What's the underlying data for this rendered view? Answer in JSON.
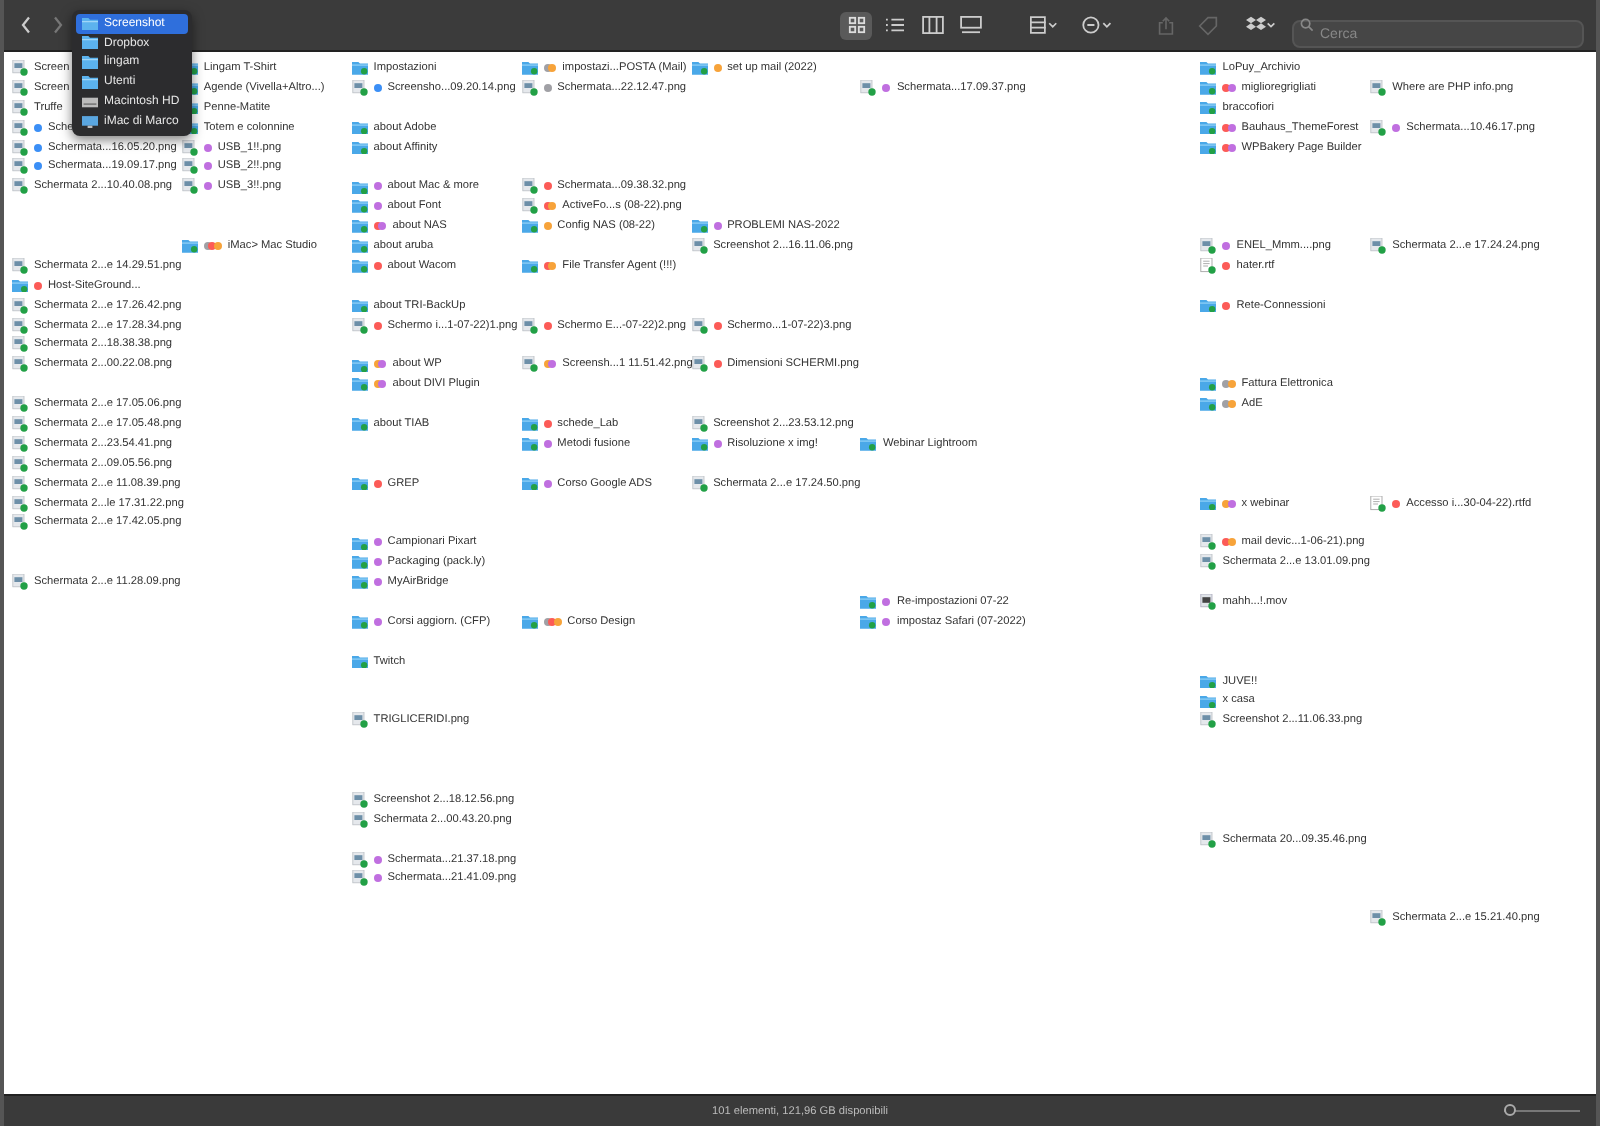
{
  "toolbar": {
    "view_buttons": [
      {
        "kind": "icons",
        "selected": true
      },
      {
        "kind": "list",
        "selected": false
      },
      {
        "kind": "columns",
        "selected": false
      },
      {
        "kind": "gallery",
        "selected": false
      }
    ],
    "search": {
      "placeholder": "Cerca"
    }
  },
  "path_menu": [
    {
      "kind": "folder",
      "label": "Screenshot",
      "selected": true
    },
    {
      "kind": "folder",
      "label": "Dropbox",
      "selected": false
    },
    {
      "kind": "folder",
      "label": "lingam",
      "selected": false
    },
    {
      "kind": "folder",
      "label": "Utenti",
      "selected": false
    },
    {
      "kind": "disk",
      "label": "Macintosh HD",
      "selected": false
    },
    {
      "kind": "computer",
      "label": "iMac di Marco",
      "selected": false
    }
  ],
  "columns": [
    {
      "slots": [
        {
          "kind": "image",
          "name": "Screen"
        },
        {
          "kind": "image",
          "name": "Screen"
        },
        {
          "kind": "image",
          "name": "Truffe"
        },
        {
          "kind": "image",
          "name": "Sche",
          "tags": [
            {
              "color": "#3b8ff6"
            }
          ]
        },
        {
          "kind": "image",
          "name": "Schermata...16.05.20.png",
          "tags": [
            {
              "color": "#3b8ff6"
            }
          ]
        },
        {
          "kind": "image",
          "name": "Schermata...19.09.17.png",
          "tags": [
            {
              "color": "#3b8ff6"
            }
          ]
        },
        {
          "kind": "image",
          "name": "Schermata 2...10.40.08.png"
        },
        {
          "kind": "blank"
        },
        {
          "kind": "blank"
        },
        {
          "kind": "blank"
        },
        {
          "kind": "image",
          "name": "Schermata 2...e 14.29.51.png"
        },
        {
          "kind": "folder",
          "name": "Host-SiteGround...",
          "tags": [
            {
              "color": "#fc5b57"
            }
          ]
        },
        {
          "kind": "image",
          "name": "Schermata 2...e 17.26.42.png"
        },
        {
          "kind": "image",
          "name": "Schermata 2...e 17.28.34.png"
        },
        {
          "kind": "image",
          "name": "Schermata 2...18.38.38.png"
        },
        {
          "kind": "image",
          "name": "Schermata 2...00.22.08.png"
        },
        {
          "kind": "blank"
        },
        {
          "kind": "image",
          "name": "Schermata 2...e 17.05.06.png"
        },
        {
          "kind": "image",
          "name": "Schermata 2...e 17.05.48.png"
        },
        {
          "kind": "image",
          "name": "Schermata 2...23.54.41.png"
        },
        {
          "kind": "image",
          "name": "Schermata 2...09.05.56.png"
        },
        {
          "kind": "image",
          "name": "Schermata 2...e 11.08.39.png"
        },
        {
          "kind": "image",
          "name": "Schermata 2...le 17.31.22.png"
        },
        {
          "kind": "image",
          "name": "Schermata 2...e 17.42.05.png"
        },
        {
          "kind": "blank"
        },
        {
          "kind": "blank"
        },
        {
          "kind": "image",
          "name": "Schermata 2...e 11.28.09.png"
        }
      ]
    },
    {
      "slots": [
        {
          "kind": "folder",
          "name": "Lingam T-Shirt"
        },
        {
          "kind": "folder",
          "name": "Agende (Vivella+Altro...)"
        },
        {
          "kind": "folder",
          "name": "Penne-Matite"
        },
        {
          "kind": "folder",
          "name": "Totem e colonnine"
        },
        {
          "kind": "image",
          "name": "USB_1!!.png",
          "tags": [
            {
              "color": "#c06fe0"
            }
          ]
        },
        {
          "kind": "image",
          "name": "USB_2!!.png",
          "tags": [
            {
              "color": "#c06fe0"
            }
          ]
        },
        {
          "kind": "image",
          "name": "USB_3!!.png",
          "tags": [
            {
              "color": "#c06fe0"
            }
          ]
        },
        {
          "kind": "blank"
        },
        {
          "kind": "blank"
        },
        {
          "kind": "folder",
          "name": "iMac> Mac Studio",
          "tags": [
            {
              "color": "#a0a0a5"
            },
            {
              "color": "#fc5b57"
            },
            {
              "color": "#f7a33a"
            }
          ]
        }
      ]
    },
    {
      "slots": [
        {
          "kind": "folder",
          "name": "Impostazioni"
        },
        {
          "kind": "image",
          "name": "Screensho...09.20.14.png",
          "tags": [
            {
              "color": "#3b8ff6"
            }
          ]
        },
        {
          "kind": "blank"
        },
        {
          "kind": "folder",
          "name": "about Adobe"
        },
        {
          "kind": "folder",
          "name": "about Affinity"
        },
        {
          "kind": "blank"
        },
        {
          "kind": "folder",
          "name": "about Mac & more",
          "tags": [
            {
              "color": "#c06fe0"
            }
          ]
        },
        {
          "kind": "folder",
          "name": "about Font",
          "tags": [
            {
              "color": "#c06fe0"
            }
          ]
        },
        {
          "kind": "folder",
          "name": "about NAS",
          "tags": [
            {
              "color": "#fc5b57"
            },
            {
              "color": "#c06fe0"
            }
          ]
        },
        {
          "kind": "folder",
          "name": "about aruba"
        },
        {
          "kind": "folder",
          "name": "about Wacom",
          "tags": [
            {
              "color": "#fc5b57"
            }
          ]
        },
        {
          "kind": "blank"
        },
        {
          "kind": "folder",
          "name": "about TRI-BackUp"
        },
        {
          "kind": "image",
          "name": "Schermo i...1-07-22)1.png",
          "tags": [
            {
              "color": "#fc5b57"
            }
          ]
        },
        {
          "kind": "blank"
        },
        {
          "kind": "folder",
          "name": "about WP",
          "tags": [
            {
              "color": "#f7a33a"
            },
            {
              "color": "#c06fe0"
            }
          ]
        },
        {
          "kind": "folder",
          "name": "about DIVI Plugin",
          "tags": [
            {
              "color": "#f7a33a"
            },
            {
              "color": "#c06fe0"
            }
          ]
        },
        {
          "kind": "blank"
        },
        {
          "kind": "folder",
          "name": "about TIAB"
        },
        {
          "kind": "blank"
        },
        {
          "kind": "blank"
        },
        {
          "kind": "folder",
          "name": "GREP",
          "tags": [
            {
              "color": "#fc5b57"
            }
          ]
        },
        {
          "kind": "blank"
        },
        {
          "kind": "blank"
        },
        {
          "kind": "folder",
          "name": "Campionari Pixart",
          "tags": [
            {
              "color": "#c06fe0"
            }
          ]
        },
        {
          "kind": "folder",
          "name": "Packaging (pack.ly)",
          "tags": [
            {
              "color": "#c06fe0"
            }
          ]
        },
        {
          "kind": "folder",
          "name": "MyAirBridge",
          "tags": [
            {
              "color": "#c06fe0"
            }
          ]
        },
        {
          "kind": "blank"
        },
        {
          "kind": "folder",
          "name": "Corsi aggiorn. (CFP)",
          "tags": [
            {
              "color": "#c06fe0"
            }
          ]
        },
        {
          "kind": "blank"
        },
        {
          "kind": "folder",
          "name": "Twitch"
        },
        {
          "kind": "blank"
        },
        {
          "kind": "blank"
        },
        {
          "kind": "image",
          "name": "TRIGLICERIDI.png"
        },
        {
          "kind": "blank"
        },
        {
          "kind": "blank"
        },
        {
          "kind": "blank"
        },
        {
          "kind": "image",
          "name": "Screenshot 2...18.12.56.png"
        },
        {
          "kind": "image",
          "name": "Schermata 2...00.43.20.png"
        },
        {
          "kind": "blank"
        },
        {
          "kind": "image",
          "name": "Schermata...21.37.18.png",
          "tags": [
            {
              "color": "#c06fe0"
            }
          ]
        },
        {
          "kind": "image",
          "name": "Schermata...21.41.09.png",
          "tags": [
            {
              "color": "#c06fe0"
            }
          ]
        }
      ]
    },
    {
      "slots": [
        {
          "kind": "folder",
          "name": "impostazi...POSTA (Mail)",
          "tags": [
            {
              "color": "#a0a0a5"
            },
            {
              "color": "#f7a33a"
            }
          ]
        },
        {
          "kind": "image",
          "name": "Schermata...22.12.47.png",
          "tags": [
            {
              "color": "#a0a0a5"
            }
          ]
        },
        {
          "kind": "blank"
        },
        {
          "kind": "blank"
        },
        {
          "kind": "blank"
        },
        {
          "kind": "blank"
        },
        {
          "kind": "image",
          "name": "Schermata...09.38.32.png",
          "tags": [
            {
              "color": "#fc5b57"
            }
          ]
        },
        {
          "kind": "image",
          "name": "ActiveFo...s (08-22).png",
          "tags": [
            {
              "color": "#fc5b57"
            },
            {
              "color": "#f7a33a"
            }
          ]
        },
        {
          "kind": "folder",
          "name": "Config NAS (08-22)",
          "tags": [
            {
              "color": "#f7a33a"
            }
          ]
        },
        {
          "kind": "blank"
        },
        {
          "kind": "folder",
          "name": "File Transfer Agent (!!!)",
          "tags": [
            {
              "color": "#fc5b57"
            },
            {
              "color": "#f7a33a"
            }
          ]
        },
        {
          "kind": "blank"
        },
        {
          "kind": "blank"
        },
        {
          "kind": "image",
          "name": "Schermo E...-07-22)2.png",
          "tags": [
            {
              "color": "#fc5b57"
            }
          ]
        },
        {
          "kind": "blank"
        },
        {
          "kind": "image",
          "name": "Screensh...1 11.51.42.png",
          "tags": [
            {
              "color": "#f7a33a"
            },
            {
              "color": "#c06fe0"
            }
          ]
        },
        {
          "kind": "blank"
        },
        {
          "kind": "blank"
        },
        {
          "kind": "folder",
          "name": "schede_Lab",
          "tags": [
            {
              "color": "#fc5b57"
            }
          ]
        },
        {
          "kind": "folder",
          "name": "Metodi fusione",
          "tags": [
            {
              "color": "#c06fe0"
            }
          ]
        },
        {
          "kind": "blank"
        },
        {
          "kind": "folder",
          "name": "Corso Google ADS",
          "tags": [
            {
              "color": "#c06fe0"
            }
          ]
        },
        {
          "kind": "blank"
        },
        {
          "kind": "blank"
        },
        {
          "kind": "blank"
        },
        {
          "kind": "blank"
        },
        {
          "kind": "blank"
        },
        {
          "kind": "blank"
        },
        {
          "kind": "folder",
          "name": "Corso Design",
          "tags": [
            {
              "color": "#a0a0a5"
            },
            {
              "color": "#fc5b57"
            },
            {
              "color": "#f7a33a"
            }
          ]
        }
      ]
    },
    {
      "slots": [
        {
          "kind": "folder",
          "name": "set up mail (2022)",
          "tags": [
            {
              "color": "#f7a33a"
            }
          ]
        },
        {
          "kind": "blank"
        },
        {
          "kind": "blank"
        },
        {
          "kind": "blank"
        },
        {
          "kind": "blank"
        },
        {
          "kind": "blank"
        },
        {
          "kind": "blank"
        },
        {
          "kind": "blank"
        },
        {
          "kind": "folder",
          "name": "PROBLEMI NAS-2022",
          "tags": [
            {
              "color": "#c06fe0"
            }
          ]
        },
        {
          "kind": "image",
          "name": "Screenshot 2...16.11.06.png"
        },
        {
          "kind": "blank"
        },
        {
          "kind": "blank"
        },
        {
          "kind": "blank"
        },
        {
          "kind": "image",
          "name": "Schermo...1-07-22)3.png",
          "tags": [
            {
              "color": "#fc5b57"
            }
          ]
        },
        {
          "kind": "blank"
        },
        {
          "kind": "image",
          "name": "Dimensioni SCHERMI.png",
          "tags": [
            {
              "color": "#fc5b57"
            }
          ]
        },
        {
          "kind": "blank"
        },
        {
          "kind": "blank"
        },
        {
          "kind": "image",
          "name": "Screenshot 2...23.53.12.png"
        },
        {
          "kind": "folder",
          "name": "Risoluzione x img!",
          "tags": [
            {
              "color": "#c06fe0"
            }
          ]
        },
        {
          "kind": "blank"
        },
        {
          "kind": "image",
          "name": "Schermata 2...e 17.24.50.png"
        }
      ]
    },
    {
      "slots": [
        {
          "kind": "blank"
        },
        {
          "kind": "image",
          "name": "Schermata...17.09.37.png",
          "tags": [
            {
              "color": "#c06fe0"
            }
          ]
        },
        {
          "kind": "blank"
        },
        {
          "kind": "blank"
        },
        {
          "kind": "blank"
        },
        {
          "kind": "blank"
        },
        {
          "kind": "blank"
        },
        {
          "kind": "blank"
        },
        {
          "kind": "blank"
        },
        {
          "kind": "blank"
        },
        {
          "kind": "blank"
        },
        {
          "kind": "blank"
        },
        {
          "kind": "blank"
        },
        {
          "kind": "blank"
        },
        {
          "kind": "blank"
        },
        {
          "kind": "blank"
        },
        {
          "kind": "blank"
        },
        {
          "kind": "blank"
        },
        {
          "kind": "blank"
        },
        {
          "kind": "folder",
          "name": "Webinar Lightroom"
        },
        {
          "kind": "blank"
        },
        {
          "kind": "blank"
        },
        {
          "kind": "blank"
        },
        {
          "kind": "blank"
        },
        {
          "kind": "blank"
        },
        {
          "kind": "blank"
        },
        {
          "kind": "blank"
        },
        {
          "kind": "folder",
          "name": "Re-impostazioni 07-22",
          "tags": [
            {
              "color": "#c06fe0"
            }
          ]
        },
        {
          "kind": "folder",
          "name": "impostaz Safari (07-2022)",
          "tags": [
            {
              "color": "#c06fe0"
            }
          ]
        }
      ]
    },
    {
      "slots": [
        {
          "kind": "blank"
        }
      ]
    },
    {
      "slots": [
        {
          "kind": "folder",
          "name": "LoPuy_Archivio"
        },
        {
          "kind": "folder",
          "name": "miglioregrigliati",
          "tags": [
            {
              "color": "#fc5b57"
            },
            {
              "color": "#c06fe0"
            }
          ]
        },
        {
          "kind": "folder",
          "name": "braccofiori"
        },
        {
          "kind": "folder",
          "name": "Bauhaus_ThemeForest",
          "tags": [
            {
              "color": "#fc5b57"
            },
            {
              "color": "#c06fe0"
            }
          ]
        },
        {
          "kind": "folder",
          "name": "WPBakery Page Builder",
          "tags": [
            {
              "color": "#fc5b57"
            },
            {
              "color": "#c06fe0"
            }
          ]
        },
        {
          "kind": "blank"
        },
        {
          "kind": "blank"
        },
        {
          "kind": "blank"
        },
        {
          "kind": "blank"
        },
        {
          "kind": "image",
          "name": "ENEL_Mmm....png",
          "tags": [
            {
              "color": "#c06fe0"
            }
          ]
        },
        {
          "kind": "document",
          "name": "hater.rtf",
          "tags": [
            {
              "color": "#fc5b57"
            }
          ]
        },
        {
          "kind": "blank"
        },
        {
          "kind": "folder",
          "name": "Rete-Connessioni",
          "tags": [
            {
              "color": "#fc5b57"
            }
          ]
        },
        {
          "kind": "blank"
        },
        {
          "kind": "blank"
        },
        {
          "kind": "blank"
        },
        {
          "kind": "folder",
          "name": "Fattura Elettronica",
          "tags": [
            {
              "color": "#a0a0a5"
            },
            {
              "color": "#f7a33a"
            }
          ]
        },
        {
          "kind": "folder",
          "name": "AdE",
          "tags": [
            {
              "color": "#a0a0a5"
            },
            {
              "color": "#f7a33a"
            }
          ]
        },
        {
          "kind": "blank"
        },
        {
          "kind": "blank"
        },
        {
          "kind": "blank"
        },
        {
          "kind": "blank"
        },
        {
          "kind": "folder",
          "name": "x webinar",
          "tags": [
            {
              "color": "#f7a33a"
            },
            {
              "color": "#c06fe0"
            }
          ]
        },
        {
          "kind": "blank"
        },
        {
          "kind": "image",
          "name": "mail devic...1-06-21).png",
          "tags": [
            {
              "color": "#fc5b57"
            },
            {
              "color": "#f7a33a"
            }
          ]
        },
        {
          "kind": "image",
          "name": "Schermata 2...e 13.01.09.png"
        },
        {
          "kind": "blank"
        },
        {
          "kind": "video",
          "name": "mahh...!.mov"
        },
        {
          "kind": "blank"
        },
        {
          "kind": "blank"
        },
        {
          "kind": "blank"
        },
        {
          "kind": "folder",
          "name": "JUVE!!"
        },
        {
          "kind": "folder",
          "name": "x casa"
        },
        {
          "kind": "image",
          "name": "Screenshot 2...11.06.33.png"
        },
        {
          "kind": "blank"
        },
        {
          "kind": "blank"
        },
        {
          "kind": "blank"
        },
        {
          "kind": "blank"
        },
        {
          "kind": "blank"
        },
        {
          "kind": "image",
          "name": "Schermata 20...09.35.46.png"
        }
      ]
    },
    {
      "slots": [
        {
          "kind": "blank"
        },
        {
          "kind": "image",
          "name": "Where are PHP info.png"
        },
        {
          "kind": "blank"
        },
        {
          "kind": "image",
          "name": "Schermata...10.46.17.png",
          "tags": [
            {
              "color": "#c06fe0"
            }
          ]
        },
        {
          "kind": "blank"
        },
        {
          "kind": "blank"
        },
        {
          "kind": "blank"
        },
        {
          "kind": "blank"
        },
        {
          "kind": "blank"
        },
        {
          "kind": "image",
          "name": "Schermata 2...e 17.24.24.png"
        },
        {
          "kind": "blank"
        },
        {
          "kind": "blank"
        },
        {
          "kind": "blank"
        },
        {
          "kind": "blank"
        },
        {
          "kind": "blank"
        },
        {
          "kind": "blank"
        },
        {
          "kind": "blank"
        },
        {
          "kind": "blank"
        },
        {
          "kind": "blank"
        },
        {
          "kind": "blank"
        },
        {
          "kind": "blank"
        },
        {
          "kind": "blank"
        },
        {
          "kind": "document",
          "name": "Accesso i...30-04-22).rtfd",
          "tags": [
            {
              "color": "#fc5b57"
            }
          ]
        },
        {
          "kind": "blank"
        },
        {
          "kind": "blank"
        },
        {
          "kind": "blank"
        },
        {
          "kind": "blank"
        },
        {
          "kind": "blank"
        },
        {
          "kind": "blank"
        },
        {
          "kind": "blank"
        },
        {
          "kind": "blank"
        },
        {
          "kind": "blank"
        },
        {
          "kind": "blank"
        },
        {
          "kind": "blank"
        },
        {
          "kind": "blank"
        },
        {
          "kind": "blank"
        },
        {
          "kind": "blank"
        },
        {
          "kind": "blank"
        },
        {
          "kind": "blank"
        },
        {
          "kind": "blank"
        },
        {
          "kind": "blank"
        },
        {
          "kind": "blank"
        },
        {
          "kind": "blank"
        },
        {
          "kind": "image",
          "name": "Schermata 2...e 15.21.40.png"
        }
      ]
    }
  ],
  "status_bar": {
    "text": "101 elementi, 121,96 GB disponibili",
    "icon_size": {
      "level": 0.0
    }
  }
}
